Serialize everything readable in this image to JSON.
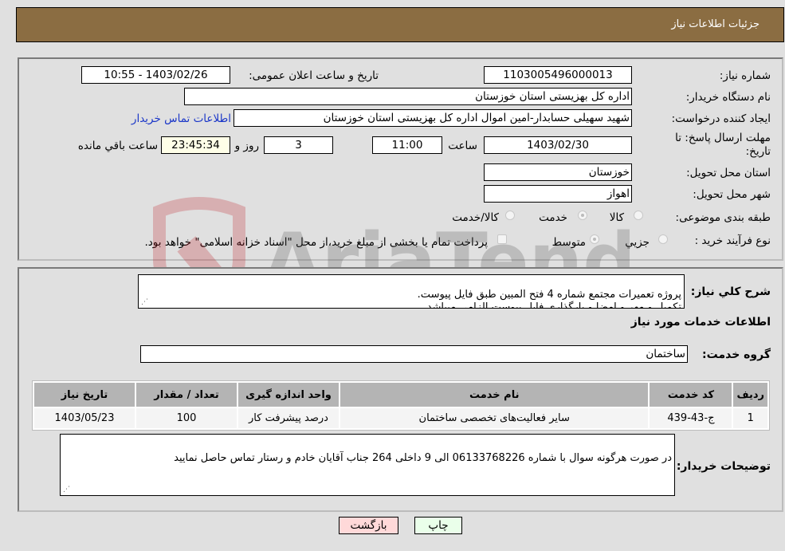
{
  "header": {
    "title": "جزئیات اطلاعات نیاز"
  },
  "form": {
    "need_number_label": "شماره نیاز:",
    "need_number": "1103005496000013",
    "announce_label": "تاریخ و ساعت اعلان عمومی:",
    "announce_value": "1403/02/26 - 10:55",
    "buyer_org_label": "نام دستگاه خریدار:",
    "buyer_org": "اداره کل بهزیستی استان خوزستان",
    "creator_label": "ایجاد کننده درخواست:",
    "creator": "شهید سهیلی حسابدار-امین اموال اداره کل بهزیستی استان خوزستان",
    "contact_link": "اطلاعات تماس خریدار",
    "deadline_label": "مهلت ارسال پاسخ: تا تاریخ:",
    "deadline_date": "1403/02/30",
    "time_label": "ساعت",
    "deadline_time": "11:00",
    "days_value": "3",
    "days_label": "روز و",
    "remaining_time": "23:45:34",
    "remaining_label": "ساعت باقي مانده",
    "province_label": "استان محل تحویل:",
    "province": "خوزستان",
    "city_label": "شهر محل تحویل:",
    "city": "اهواز",
    "category_label": "طبقه بندی موضوعی:",
    "category_options": [
      {
        "label": "کالا",
        "checked": false
      },
      {
        "label": "خدمت",
        "checked": true
      },
      {
        "label": "کالا/خدمت",
        "checked": false
      }
    ],
    "process_label": "نوع فرآیند خرید :",
    "process_options": [
      {
        "label": "جزيي",
        "checked": false
      },
      {
        "label": "متوسط",
        "checked": true
      }
    ],
    "treasury_note": "پرداخت تمام یا بخشی از مبلغ خرید،از محل \"اسناد خزانه اسلامی\" خواهد بود.",
    "treasury_checked": false
  },
  "details": {
    "description_label": "شرح کلي نیاز:",
    "description": "پروژه تعمیرات مجتمع شماره 4 فتح المبین طبق فایل پیوست.\nتکمیل و مهر و امضا و بارگذاری فایل پیوست الزامی میباشد",
    "services_title": "اطلاعات خدمات مورد نیاز",
    "service_group_label": "گروه خدمت:",
    "service_group": "ساختمان",
    "table": {
      "headers": [
        "ردیف",
        "کد خدمت",
        "نام خدمت",
        "واحد اندازه گیری",
        "تعداد / مقدار",
        "تاریخ نیاز"
      ],
      "rows": [
        [
          "1",
          "ج-43-439",
          "سایر فعالیت‌های تخصصی ساختمان",
          "درصد پیشرفت کار",
          "100",
          "1403/05/23"
        ]
      ]
    },
    "buyer_notes_label": "توضیحات خریدار:",
    "buyer_notes": "در صورت هرگونه سوال با شماره 06133768226 الی 9 داخلی 264 جناب آقایان خادم و رستار تماس حاصل نمایید"
  },
  "buttons": {
    "print": "چاپ",
    "back": "بازگشت"
  },
  "watermark": {
    "text": "AriaTender.neT"
  }
}
